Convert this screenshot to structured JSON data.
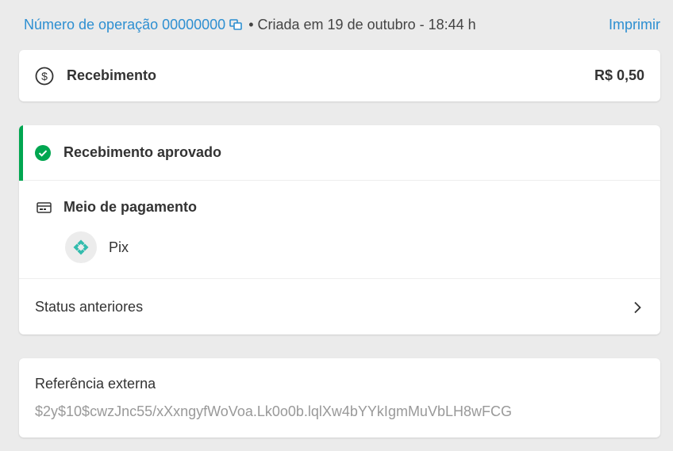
{
  "header": {
    "operation_label": "Número de operação 00000000",
    "created_text": "Criada em 19 de outubro - 18:44 h",
    "separator": "•",
    "print_label": "Imprimir"
  },
  "amount_card": {
    "title": "Recebimento",
    "amount": "R$ 0,50",
    "icon": "dollar-circle-icon"
  },
  "status_card": {
    "status_label": "Recebimento aprovado",
    "status_color": "#00a650",
    "payment_method_heading": "Meio de pagamento",
    "payment_method": "Pix",
    "pix_color": "#32bcad",
    "history_label": "Status anteriores"
  },
  "reference_card": {
    "label": "Referência externa",
    "value": "$2y$10$cwzJnc55/xXxngyfWoVoa.Lk0o0b.lqlXw4bYYkIgmMuVbLH8wFCG"
  },
  "colors": {
    "link": "#2d8fd1",
    "background": "#ebebeb",
    "success": "#00a650"
  }
}
